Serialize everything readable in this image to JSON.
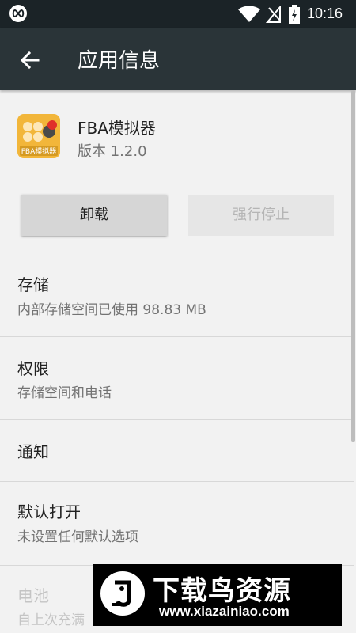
{
  "status_bar": {
    "time": "10:16",
    "icons": [
      "infinity-icon",
      "wifi-icon",
      "no-signal-icon",
      "battery-charging-icon"
    ]
  },
  "app_bar": {
    "title": "应用信息",
    "back_icon": "arrow-left-icon"
  },
  "app": {
    "name": "FBA模拟器",
    "version": "版本 1.2.0",
    "icon_label": "FBA模拟器",
    "icon_color": "#f2b63a"
  },
  "buttons": {
    "uninstall": "卸载",
    "force_stop": "强行停止"
  },
  "settings": [
    {
      "title": "存储",
      "subtitle": "内部存储空间已使用 98.83 MB"
    },
    {
      "title": "权限",
      "subtitle": "存储空间和电话"
    },
    {
      "title": "通知",
      "subtitle": ""
    },
    {
      "title": "默认打开",
      "subtitle": "未设置任何默认选项"
    },
    {
      "title": "电池",
      "subtitle": "自上次充满"
    }
  ],
  "watermark": {
    "text": "下载鸟资源",
    "url": "www.xiazainiao.com"
  },
  "colors": {
    "status_bar": "#1b2327",
    "app_bar": "#2a3438",
    "background": "#f2f2f2"
  }
}
